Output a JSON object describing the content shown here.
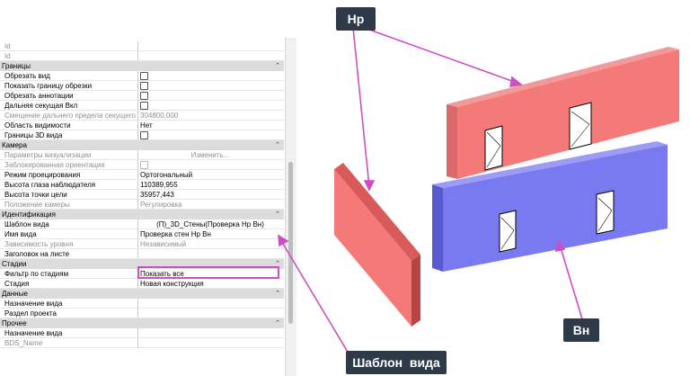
{
  "properties": {
    "rows": [
      {
        "type": "prop",
        "name": "Id",
        "value": "",
        "disabled": true
      },
      {
        "type": "prop",
        "name": "Id",
        "value": "",
        "disabled": true
      },
      {
        "type": "section",
        "name": "Границы"
      },
      {
        "type": "check",
        "name": "Обрезать вид"
      },
      {
        "type": "check",
        "name": "Показать границу обрезки"
      },
      {
        "type": "check",
        "name": "Обрезать аннотации"
      },
      {
        "type": "check",
        "name": "Дальняя секущая Вкл"
      },
      {
        "type": "prop",
        "name": "Смещение дальнего предела секущего ...",
        "value": "304800,000",
        "disabled": true
      },
      {
        "type": "prop",
        "name": "Область видимости",
        "value": "Нет"
      },
      {
        "type": "check",
        "name": "Границы 3D вида"
      },
      {
        "type": "section",
        "name": "Камера"
      },
      {
        "type": "button",
        "name": "Параметры визуализации",
        "value": "Изменить...",
        "disabled": true
      },
      {
        "type": "check",
        "name": "Заблокированная ориентация",
        "disabled": true
      },
      {
        "type": "prop",
        "name": "Режим проецирования",
        "value": "Ортогональный"
      },
      {
        "type": "prop",
        "name": "Высота глаза наблюдателя",
        "value": "110389,955"
      },
      {
        "type": "prop",
        "name": "Высота точки цели",
        "value": "35957,443"
      },
      {
        "type": "prop",
        "name": "Положение камеры",
        "value": "Регулировка",
        "disabled": true
      },
      {
        "type": "section",
        "name": "Идентификация"
      },
      {
        "type": "template",
        "name": "Шаблон вида",
        "value": "(П)_3D_Стены(Проверка Нр Вн)"
      },
      {
        "type": "prop",
        "name": "Имя вида",
        "value": "Проверка стен Нр Вн"
      },
      {
        "type": "prop",
        "name": "Зависимость уровня",
        "value": "Независимый",
        "disabled": true
      },
      {
        "type": "prop",
        "name": "Заголовок на листе",
        "value": ""
      },
      {
        "type": "section",
        "name": "Стадии"
      },
      {
        "type": "prop",
        "name": "Фильтр по стадиям",
        "value": "Показать все"
      },
      {
        "type": "prop",
        "name": "Стадия",
        "value": "Новая конструкция"
      },
      {
        "type": "section",
        "name": "Данные"
      },
      {
        "type": "prop",
        "name": "Назначение вида",
        "value": ""
      },
      {
        "type": "prop",
        "name": "Раздел проекта",
        "value": ""
      },
      {
        "type": "section",
        "name": "Прочее"
      },
      {
        "type": "prop",
        "name": "Назначение вида",
        "value": ""
      },
      {
        "type": "prop",
        "name": "BDS_Name",
        "value": "",
        "disabled": true
      }
    ]
  },
  "callouts": {
    "hr": "Нр",
    "vn": "Вн",
    "template": "Шаблон  вида"
  },
  "colors": {
    "wall_outer": "#f47a7a",
    "wall_inner": "#7a7af0",
    "highlight": "#cc4fc4",
    "callout_bg": "#2e3a48"
  }
}
